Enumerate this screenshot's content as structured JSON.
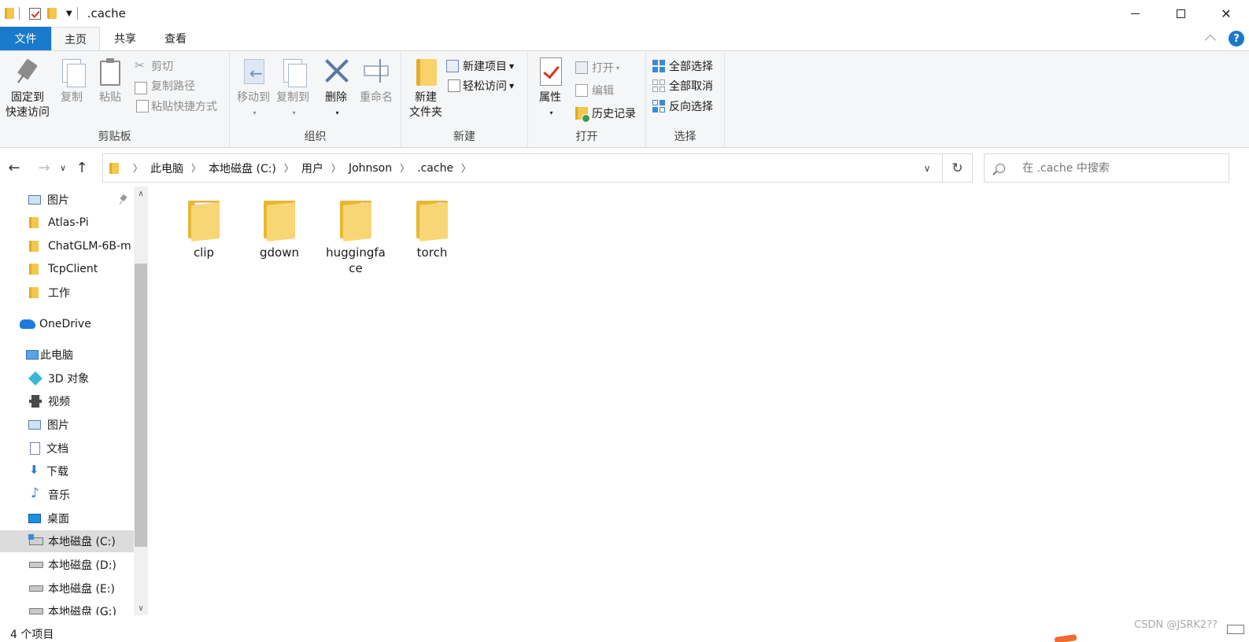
{
  "window": {
    "title": ".cache",
    "controls": {
      "minimize": "—",
      "maximize": "☐",
      "close": "✕"
    }
  },
  "ribbon_tabs": [
    {
      "label": "文件"
    },
    {
      "label": "主页"
    },
    {
      "label": "共享"
    },
    {
      "label": "查看"
    }
  ],
  "ribbon": {
    "clipboard": {
      "label": "剪贴板",
      "pin_line1": "固定到",
      "pin_line2": "快速访问",
      "copy": "复制",
      "paste": "粘贴",
      "cut": "剪切",
      "copy_path": "复制路径",
      "paste_shortcut": "粘贴快捷方式"
    },
    "organize": {
      "label": "组织",
      "move_to": "移动到",
      "copy_to": "复制到",
      "delete": "删除",
      "rename": "重命名"
    },
    "new": {
      "label": "新建",
      "new_folder_line1": "新建",
      "new_folder_line2": "文件夹",
      "new_item": "新建项目",
      "easy_access": "轻松访问"
    },
    "open": {
      "label": "打开",
      "properties": "属性",
      "open": "打开",
      "edit": "编辑",
      "history": "历史记录"
    },
    "select": {
      "label": "选择",
      "select_all": "全部选择",
      "select_none": "全部取消",
      "invert": "反向选择"
    }
  },
  "address_bar": {
    "breadcrumbs": [
      "此电脑",
      "本地磁盘 (C:)",
      "用户",
      "Johnson",
      ".cache"
    ]
  },
  "search": {
    "placeholder": "在 .cache 中搜索"
  },
  "sidebar": {
    "items": [
      {
        "label": "图片",
        "icon": "pictures-icon"
      },
      {
        "label": "Atlas-Pi",
        "icon": "folder-icon"
      },
      {
        "label": "ChatGLM-6B-m",
        "icon": "folder-icon"
      },
      {
        "label": "TcpClient",
        "icon": "folder-icon"
      },
      {
        "label": "工作",
        "icon": "folder-icon"
      },
      {
        "label": "OneDrive",
        "icon": "onedrive-icon"
      },
      {
        "label": "此电脑",
        "icon": "this-pc-icon"
      },
      {
        "label": "3D 对象",
        "icon": "3d-objects-icon"
      },
      {
        "label": "视频",
        "icon": "video-icon"
      },
      {
        "label": "图片",
        "icon": "pictures-icon"
      },
      {
        "label": "文档",
        "icon": "documents-icon"
      },
      {
        "label": "下载",
        "icon": "downloads-icon"
      },
      {
        "label": "音乐",
        "icon": "music-icon"
      },
      {
        "label": "桌面",
        "icon": "desktop-icon"
      },
      {
        "label": "本地磁盘 (C:)",
        "icon": "system-drive-icon"
      },
      {
        "label": "本地磁盘 (D:)",
        "icon": "drive-icon"
      },
      {
        "label": "本地磁盘 (E:)",
        "icon": "drive-icon"
      },
      {
        "label": "本地磁盘 (G:)",
        "icon": "drive-icon"
      }
    ]
  },
  "files": [
    {
      "name": "clip"
    },
    {
      "name": "gdown"
    },
    {
      "name": "huggingface"
    },
    {
      "name": "torch"
    }
  ],
  "status": {
    "count": "4 个项目"
  },
  "watermark": "CSDN @JSRK2??",
  "colors": {
    "accent": "#1979ca",
    "folder": "#f3c64d",
    "selected": "#dcdcdc"
  }
}
